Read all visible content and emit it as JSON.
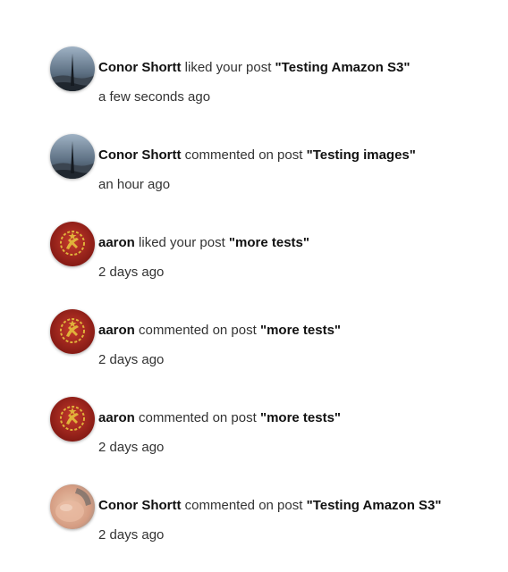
{
  "notifications": [
    {
      "avatar": "tower-landscape-avatar",
      "user": "Conor Shortt",
      "action": "liked your post",
      "post_title": "\"Testing Amazon S3\"",
      "time": "a few seconds ago"
    },
    {
      "avatar": "tower-landscape-avatar",
      "user": "Conor Shortt",
      "action": "commented on post",
      "post_title": "\"Testing images\"",
      "time": "an hour ago"
    },
    {
      "avatar": "red-emblem-avatar",
      "user": "aaron",
      "action": "liked your post",
      "post_title": "\"more tests\"",
      "time": "2 days ago"
    },
    {
      "avatar": "red-emblem-avatar",
      "user": "aaron",
      "action": "commented on post",
      "post_title": "\"more tests\"",
      "time": "2 days ago"
    },
    {
      "avatar": "red-emblem-avatar",
      "user": "aaron",
      "action": "commented on post",
      "post_title": "\"more tests\"",
      "time": "2 days ago"
    },
    {
      "avatar": "blurred-face-avatar",
      "user": "Conor Shortt",
      "action": "commented on post",
      "post_title": "\"Testing Amazon S3\"",
      "time": "2 days ago"
    }
  ],
  "colors": {
    "text": "#212121",
    "emblem_red": "#a4231d",
    "emblem_gold": "#e0b23a",
    "tower_sky": "#7f94a8"
  }
}
